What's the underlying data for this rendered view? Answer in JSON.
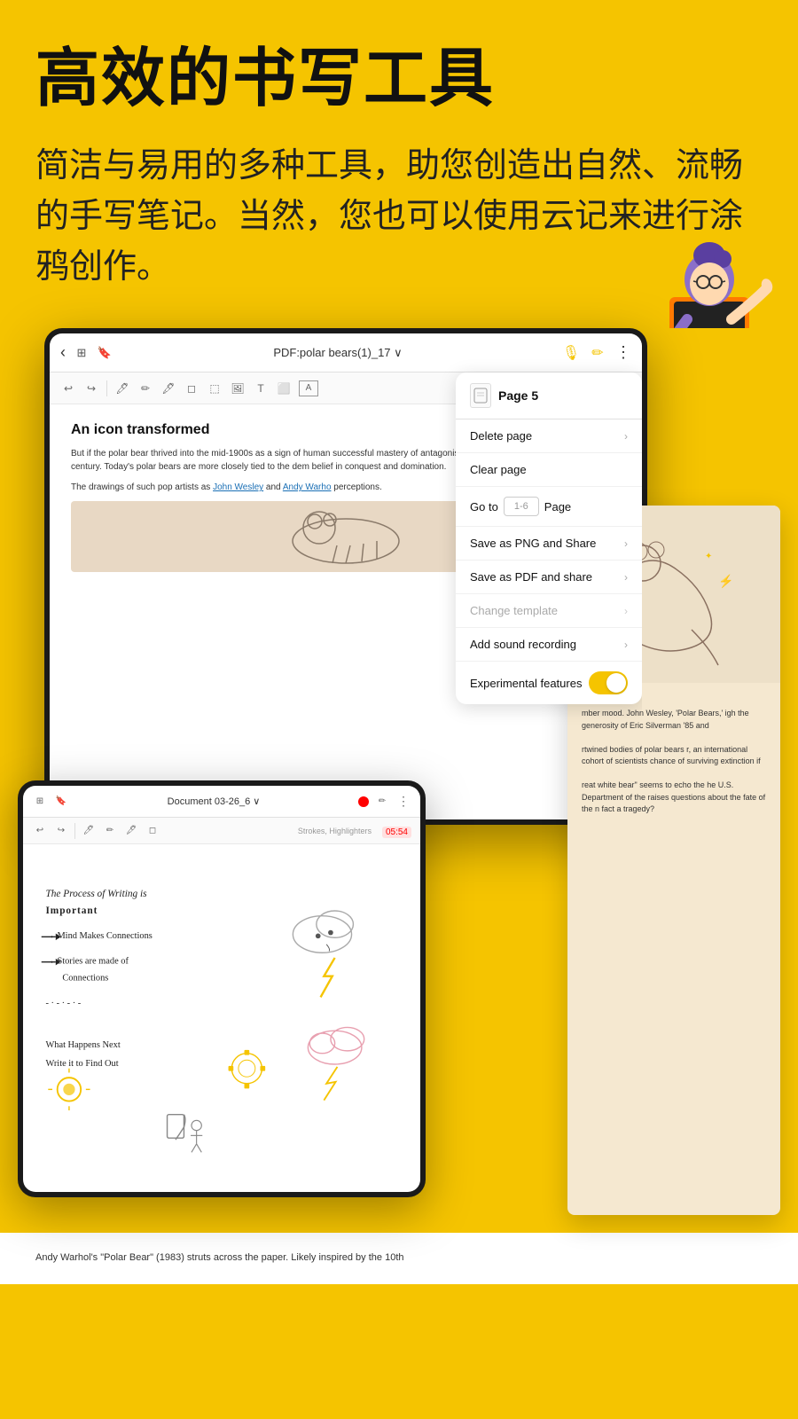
{
  "hero": {
    "title": "高效的书写工具",
    "description": "简洁与易用的多种工具，助您创造出自然、流畅的手写笔记。当然，您也可以使用云记来进行涂鸦创作。"
  },
  "tablet_main": {
    "toolbar": {
      "doc_title": "PDF:polar bears(1)_17 ∨",
      "mic_icon": "🎙",
      "pen_icon": "✏",
      "dots_icon": "⋮"
    }
  },
  "context_menu": {
    "page_title": "Page 5",
    "items": [
      {
        "label": "Delete page",
        "type": "normal",
        "chevron": true
      },
      {
        "label": "Clear page",
        "type": "normal",
        "chevron": false
      },
      {
        "label": "Go to",
        "type": "goto",
        "placeholder": "1-6",
        "page_label": "Page",
        "chevron": false
      },
      {
        "label": "Save as PNG and Share",
        "type": "normal",
        "chevron": true
      },
      {
        "label": "Save as PDF and share",
        "type": "normal",
        "chevron": true
      },
      {
        "label": "Change template",
        "type": "disabled",
        "chevron": true
      },
      {
        "label": "Add sound recording",
        "type": "normal",
        "chevron": true
      },
      {
        "label": "Experimental features",
        "type": "toggle",
        "toggled": true
      }
    ]
  },
  "doc_content": {
    "title": "An icon transformed",
    "body1": "But if the polar bear thrived into the mid-1900s as a sign of human successful mastery of antagonistic forces, this symbolic associatio 20th century. Today's polar bears are more closely tied to the dem belief in conquest and domination.",
    "body2": "The drawings of such pop artists as John Wesley and Andy Warho perceptions.",
    "link1": "John Wesley",
    "link2": "Andy Warhol"
  },
  "bottom_tablet": {
    "doc_title": "Document 03-26_6 ∨",
    "timer": "05:54",
    "strokes_label": "Strokes, Highlighters",
    "handwriting": [
      "The Process of Writing is",
      "Important",
      "→ Mind Makes Connections",
      "→ Stories are made of",
      "   Connections",
      "What Happens Next",
      "Write it to Find Out"
    ]
  },
  "pdf_right": {
    "caption1": "mber mood. John Wesley, 'Polar Bears,' igh the generosity of Eric Silverman '85 and",
    "caption2": "rtwined bodies of polar bears r, an international cohort of scientists chance of surviving extinction if",
    "caption3": "reat white bear\" seems to echo the he U.S. Department of the raises questions about the fate of the n fact a tragedy?"
  },
  "bottom_bar": {
    "text": "Andy Warhol's \"Polar Bear\" (1983) struts across the paper. Likely inspired by the 10th",
    "dept_text": "Department of the"
  },
  "colors": {
    "yellow": "#F5C400",
    "dark": "#1a1a1a",
    "text": "#111111"
  }
}
